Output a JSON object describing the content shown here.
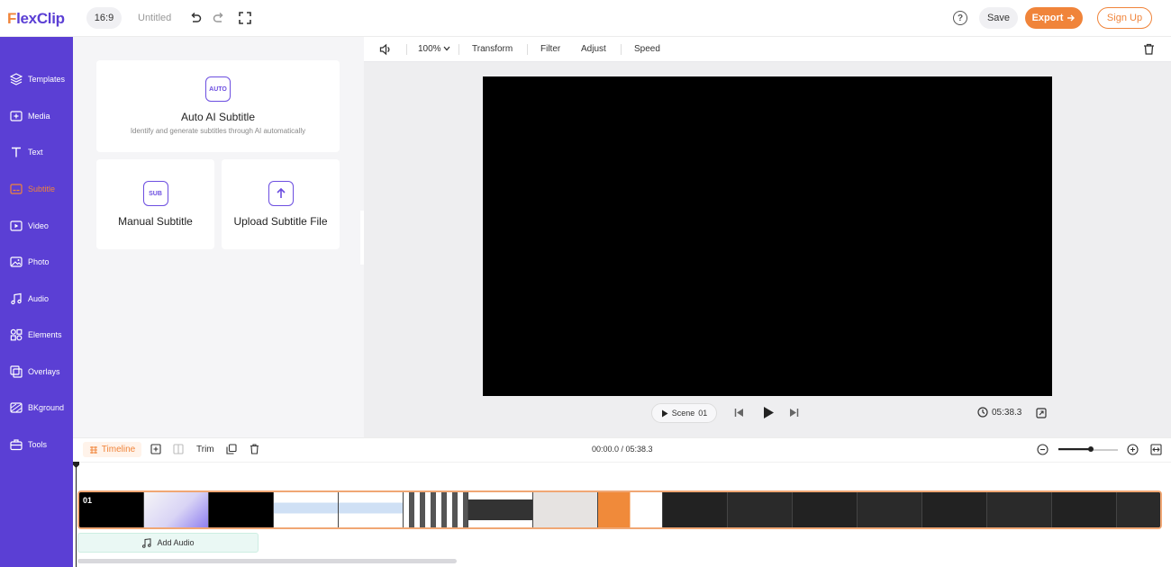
{
  "app": {
    "logo_f": "F",
    "logo_rest": "lexClip"
  },
  "topbar": {
    "ratio": "16:9",
    "project_title": "Untitled",
    "help": "?",
    "save": "Save",
    "export": "Export",
    "signup": "Sign Up"
  },
  "sidebar": {
    "items": [
      {
        "label": "Templates",
        "icon": "layers-icon"
      },
      {
        "label": "Media",
        "icon": "media-icon"
      },
      {
        "label": "Text",
        "icon": "text-icon"
      },
      {
        "label": "Subtitle",
        "icon": "subtitle-icon",
        "active": true
      },
      {
        "label": "Video",
        "icon": "video-icon"
      },
      {
        "label": "Photo",
        "icon": "photo-icon"
      },
      {
        "label": "Audio",
        "icon": "audio-icon"
      },
      {
        "label": "Elements",
        "icon": "elements-icon"
      },
      {
        "label": "Overlays",
        "icon": "overlays-icon"
      },
      {
        "label": "BKground",
        "icon": "background-icon"
      },
      {
        "label": "Tools",
        "icon": "tools-icon"
      }
    ],
    "active_color": "#f0843a"
  },
  "panel": {
    "auto": {
      "icon_text": "AUTO",
      "title": "Auto AI Subtitle",
      "desc": "Identify and generate subtitles through AI automatically"
    },
    "manual": {
      "icon_text": "SUB",
      "title": "Manual Subtitle"
    },
    "upload": {
      "title": "Upload Subtitle File"
    }
  },
  "toolbar": {
    "zoom": "100%",
    "transform": "Transform",
    "filter": "Filter",
    "adjust": "Adjust",
    "speed": "Speed"
  },
  "player": {
    "scene": "Scene",
    "scene_num": "01",
    "duration": "05:38.3"
  },
  "timeline": {
    "tab": "Timeline",
    "trim": "Trim",
    "time": "00:00.0 / 05:38.3",
    "clip_label": "01",
    "add_audio": "Add Audio",
    "zoom_level": 0.55
  },
  "colors": {
    "brand_purple": "#5b3fd4",
    "accent_orange": "#f0843a"
  }
}
